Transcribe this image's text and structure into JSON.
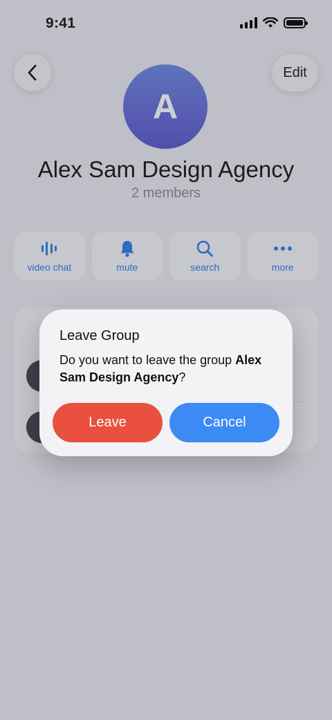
{
  "status": {
    "time": "9:41"
  },
  "nav": {
    "edit_label": "Edit"
  },
  "profile": {
    "initial": "A",
    "name": "Alex Sam Design Agency",
    "members": "2 members"
  },
  "actions": [
    {
      "label": "video chat",
      "icon": "waveform-icon"
    },
    {
      "label": "mute",
      "icon": "bell-icon"
    },
    {
      "label": "search",
      "icon": "search-icon"
    },
    {
      "label": "more",
      "icon": "more-dots-icon"
    }
  ],
  "dialog": {
    "title": "Leave Group",
    "message_prefix": "Do you want to leave the group ",
    "message_group": "Alex Sam Design Agency",
    "message_suffix": "?",
    "leave_label": "Leave",
    "cancel_label": "Cancel"
  },
  "colors": {
    "accent": "#2b7de9",
    "danger": "#e9503f",
    "primary_button": "#3c8af3"
  }
}
